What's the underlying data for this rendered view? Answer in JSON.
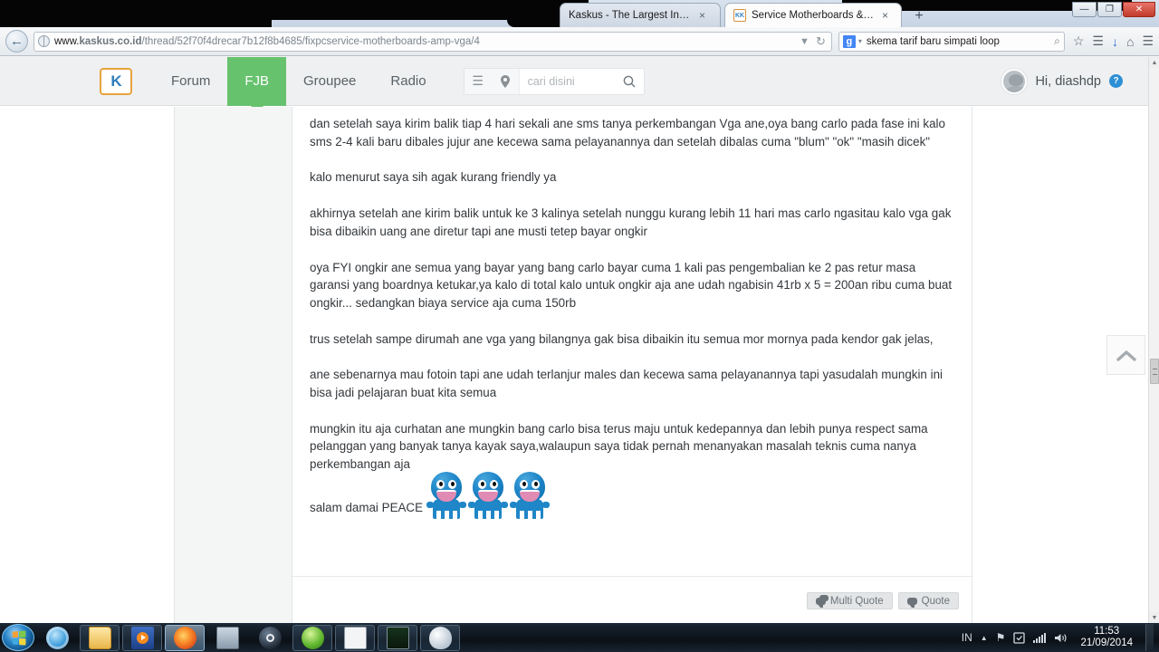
{
  "browser": {
    "tabs": [
      {
        "title": "Kaskus - The Largest Indon...",
        "close": "×",
        "active": false
      },
      {
        "title": "Service Motherboards & V...",
        "close": "×",
        "active": true,
        "favicon_label": "KK"
      }
    ],
    "newtab_label": "+",
    "window_controls": {
      "minimize": "—",
      "maximize": "❐",
      "close": "✕"
    },
    "back_arrow": "←",
    "url": {
      "host_prefix": "www.",
      "host_bold": "kaskus.co.id",
      "path": "/thread/52f70f4drecar7b12f8b4685/fixpcservice-motherboards-amp-vga/4",
      "dropdown_caret": "▼",
      "reload": "↻"
    },
    "search": {
      "engine_letter": "g",
      "caret": "▾",
      "value": "skema tarif baru simpati loop",
      "magnifier": "⌕"
    },
    "toolbar_icons": [
      {
        "name": "bookmark-star-icon",
        "glyph": "☆"
      },
      {
        "name": "reading-list-icon",
        "glyph": "☰"
      },
      {
        "name": "download-arrow-icon",
        "glyph": "↓"
      },
      {
        "name": "home-icon",
        "glyph": "⌂"
      },
      {
        "name": "hamburger-menu-icon",
        "glyph": "☰"
      }
    ]
  },
  "kaskus": {
    "logo_text": "K",
    "nav": [
      {
        "label": "Forum",
        "active": false
      },
      {
        "label": "FJB",
        "active": true
      },
      {
        "label": "Groupee",
        "active": false
      },
      {
        "label": "Radio",
        "active": false
      }
    ],
    "search": {
      "list_icon": "☰",
      "pin_icon": "●",
      "placeholder": "cari disini",
      "magnifier": "⌕"
    },
    "user": {
      "greeting": "Hi, diashdp",
      "help_badge": "?"
    },
    "accent_green": "#67c26e",
    "logo_border": "#e8a33d"
  },
  "post": {
    "paragraphs": [
      "dan setelah saya kirim balik tiap 4 hari sekali ane sms tanya perkembangan Vga ane,oya bang carlo pada fase ini kalo sms 2-4 kali baru dibales jujur ane kecewa sama pelayanannya dan setelah dibalas cuma \"blum\" \"ok\" \"masih dicek\"",
      "kalo menurut saya sih agak kurang friendly ya",
      "akhirnya setelah ane kirim balik untuk ke 3 kalinya setelah nunggu kurang lebih 11 hari mas carlo ngasitau kalo vga gak bisa dibaikin uang ane diretur tapi ane musti tetep bayar ongkir",
      "oya FYI ongkir ane semua yang bayar yang bang carlo bayar cuma 1 kali pas pengembalian ke 2 pas retur masa garansi yang boardnya ketukar,ya kalo di total kalo untuk ongkir aja ane udah ngabisin 41rb x 5 = 200an ribu cuma buat ongkir... sedangkan biaya service aja cuma 150rb",
      "trus setelah sampe dirumah ane vga yang bilangnya gak bisa dibaikin itu semua mor mornya pada kendor gak jelas,",
      "ane sebenarnya mau fotoin tapi ane udah terlanjur males dan kecewa sama pelayanannya tapi yasudalah mungkin ini bisa jadi pelajaran buat kita semua",
      "mungkin itu aja curhatan ane mungkin bang carlo bisa terus maju untuk kedepannya dan lebih punya respect sama pelanggan yang banyak tanya kayak saya,walaupun saya tidak pernah menanyakan masalah teknis cuma nanya perkembangan aja"
    ],
    "signoff": "salam damai PEACE",
    "emoticon_count": 3,
    "emoticon_name": "blue-peace-smiley",
    "footer_buttons": [
      {
        "label": "Multi Quote",
        "icon": "multi-speech-bubble-icon"
      },
      {
        "label": "Quote",
        "icon": "speech-bubble-icon"
      }
    ]
  },
  "widgets": {
    "back_to_top": "⌃",
    "scroll_up": "▲",
    "scroll_down": "▼"
  },
  "taskbar": {
    "start_label": "Start",
    "items": [
      {
        "name": "internet-explorer",
        "framed": false
      },
      {
        "name": "windows-explorer",
        "framed": true
      },
      {
        "name": "media-player",
        "framed": true
      },
      {
        "name": "firefox",
        "framed": true,
        "active": true
      },
      {
        "name": "remote-desktop",
        "framed": false
      },
      {
        "name": "steam",
        "framed": false
      },
      {
        "name": "download-manager",
        "framed": true
      },
      {
        "name": "window-app",
        "framed": true
      },
      {
        "name": "system-monitor",
        "framed": true
      },
      {
        "name": "paint",
        "framed": true
      }
    ],
    "tray": {
      "language": "IN",
      "show_hidden": "▲",
      "flag_icon": "⚑",
      "action_center_icon": "⚑",
      "network_icon": "signal-bars",
      "volume_icon": "ᵔ",
      "time": "11:53",
      "date": "21/09/2014"
    }
  }
}
